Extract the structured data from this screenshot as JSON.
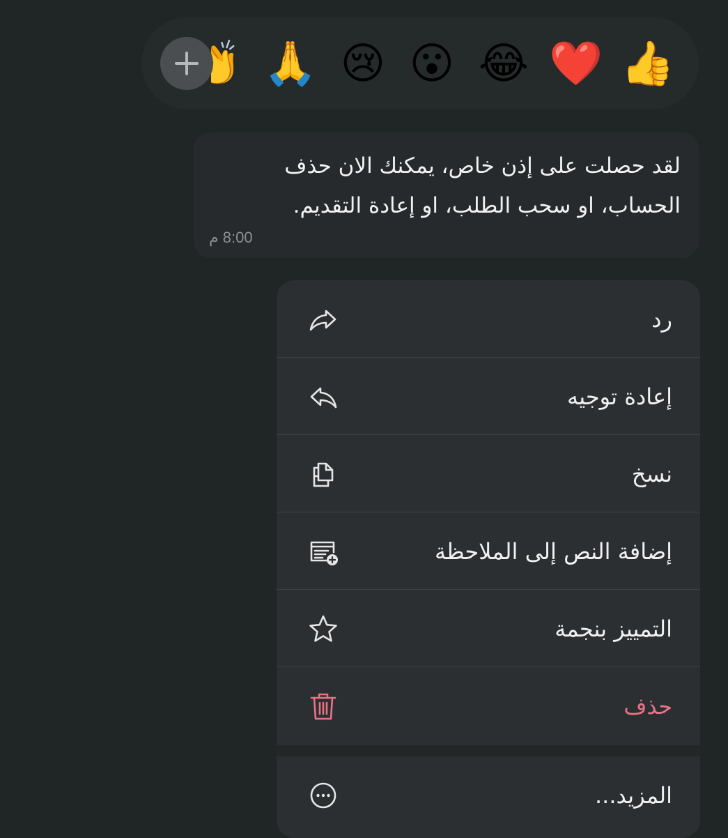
{
  "reactions": {
    "items": [
      {
        "emoji": "👍",
        "name": "thumbs-up"
      },
      {
        "emoji": "❤️",
        "name": "red-heart"
      },
      {
        "emoji": "😂",
        "name": "tears-of-joy"
      },
      {
        "emoji": "😮",
        "name": "open-mouth"
      },
      {
        "emoji": "😢",
        "name": "crying-face"
      },
      {
        "emoji": "🙏",
        "name": "folded-hands"
      }
    ],
    "partial_emoji": "👏",
    "add_icon": "plus-icon"
  },
  "message": {
    "text": "لقد حصلت على إذن خاص، يمكنك الان حذف الحساب، او سحب الطلب، او إعادة التقديم.",
    "time": "8:00 م"
  },
  "menu": {
    "items": [
      {
        "label": "رد",
        "icon": "reply-icon"
      },
      {
        "label": "إعادة توجيه",
        "icon": "forward-icon"
      },
      {
        "label": "نسخ",
        "icon": "copy-icon"
      },
      {
        "label": "إضافة النص إلى الملاحظة",
        "icon": "add-note-icon"
      },
      {
        "label": "التمييز بنجمة",
        "icon": "star-icon"
      },
      {
        "label": "حذف",
        "icon": "trash-icon",
        "color": "#e87386"
      }
    ],
    "more": {
      "label": "المزيد...",
      "icon": "more-icon"
    }
  },
  "colors": {
    "background": "#1f2625",
    "menu": "#2c2f31",
    "danger": "#e87386",
    "text": "#f1f1f1"
  }
}
